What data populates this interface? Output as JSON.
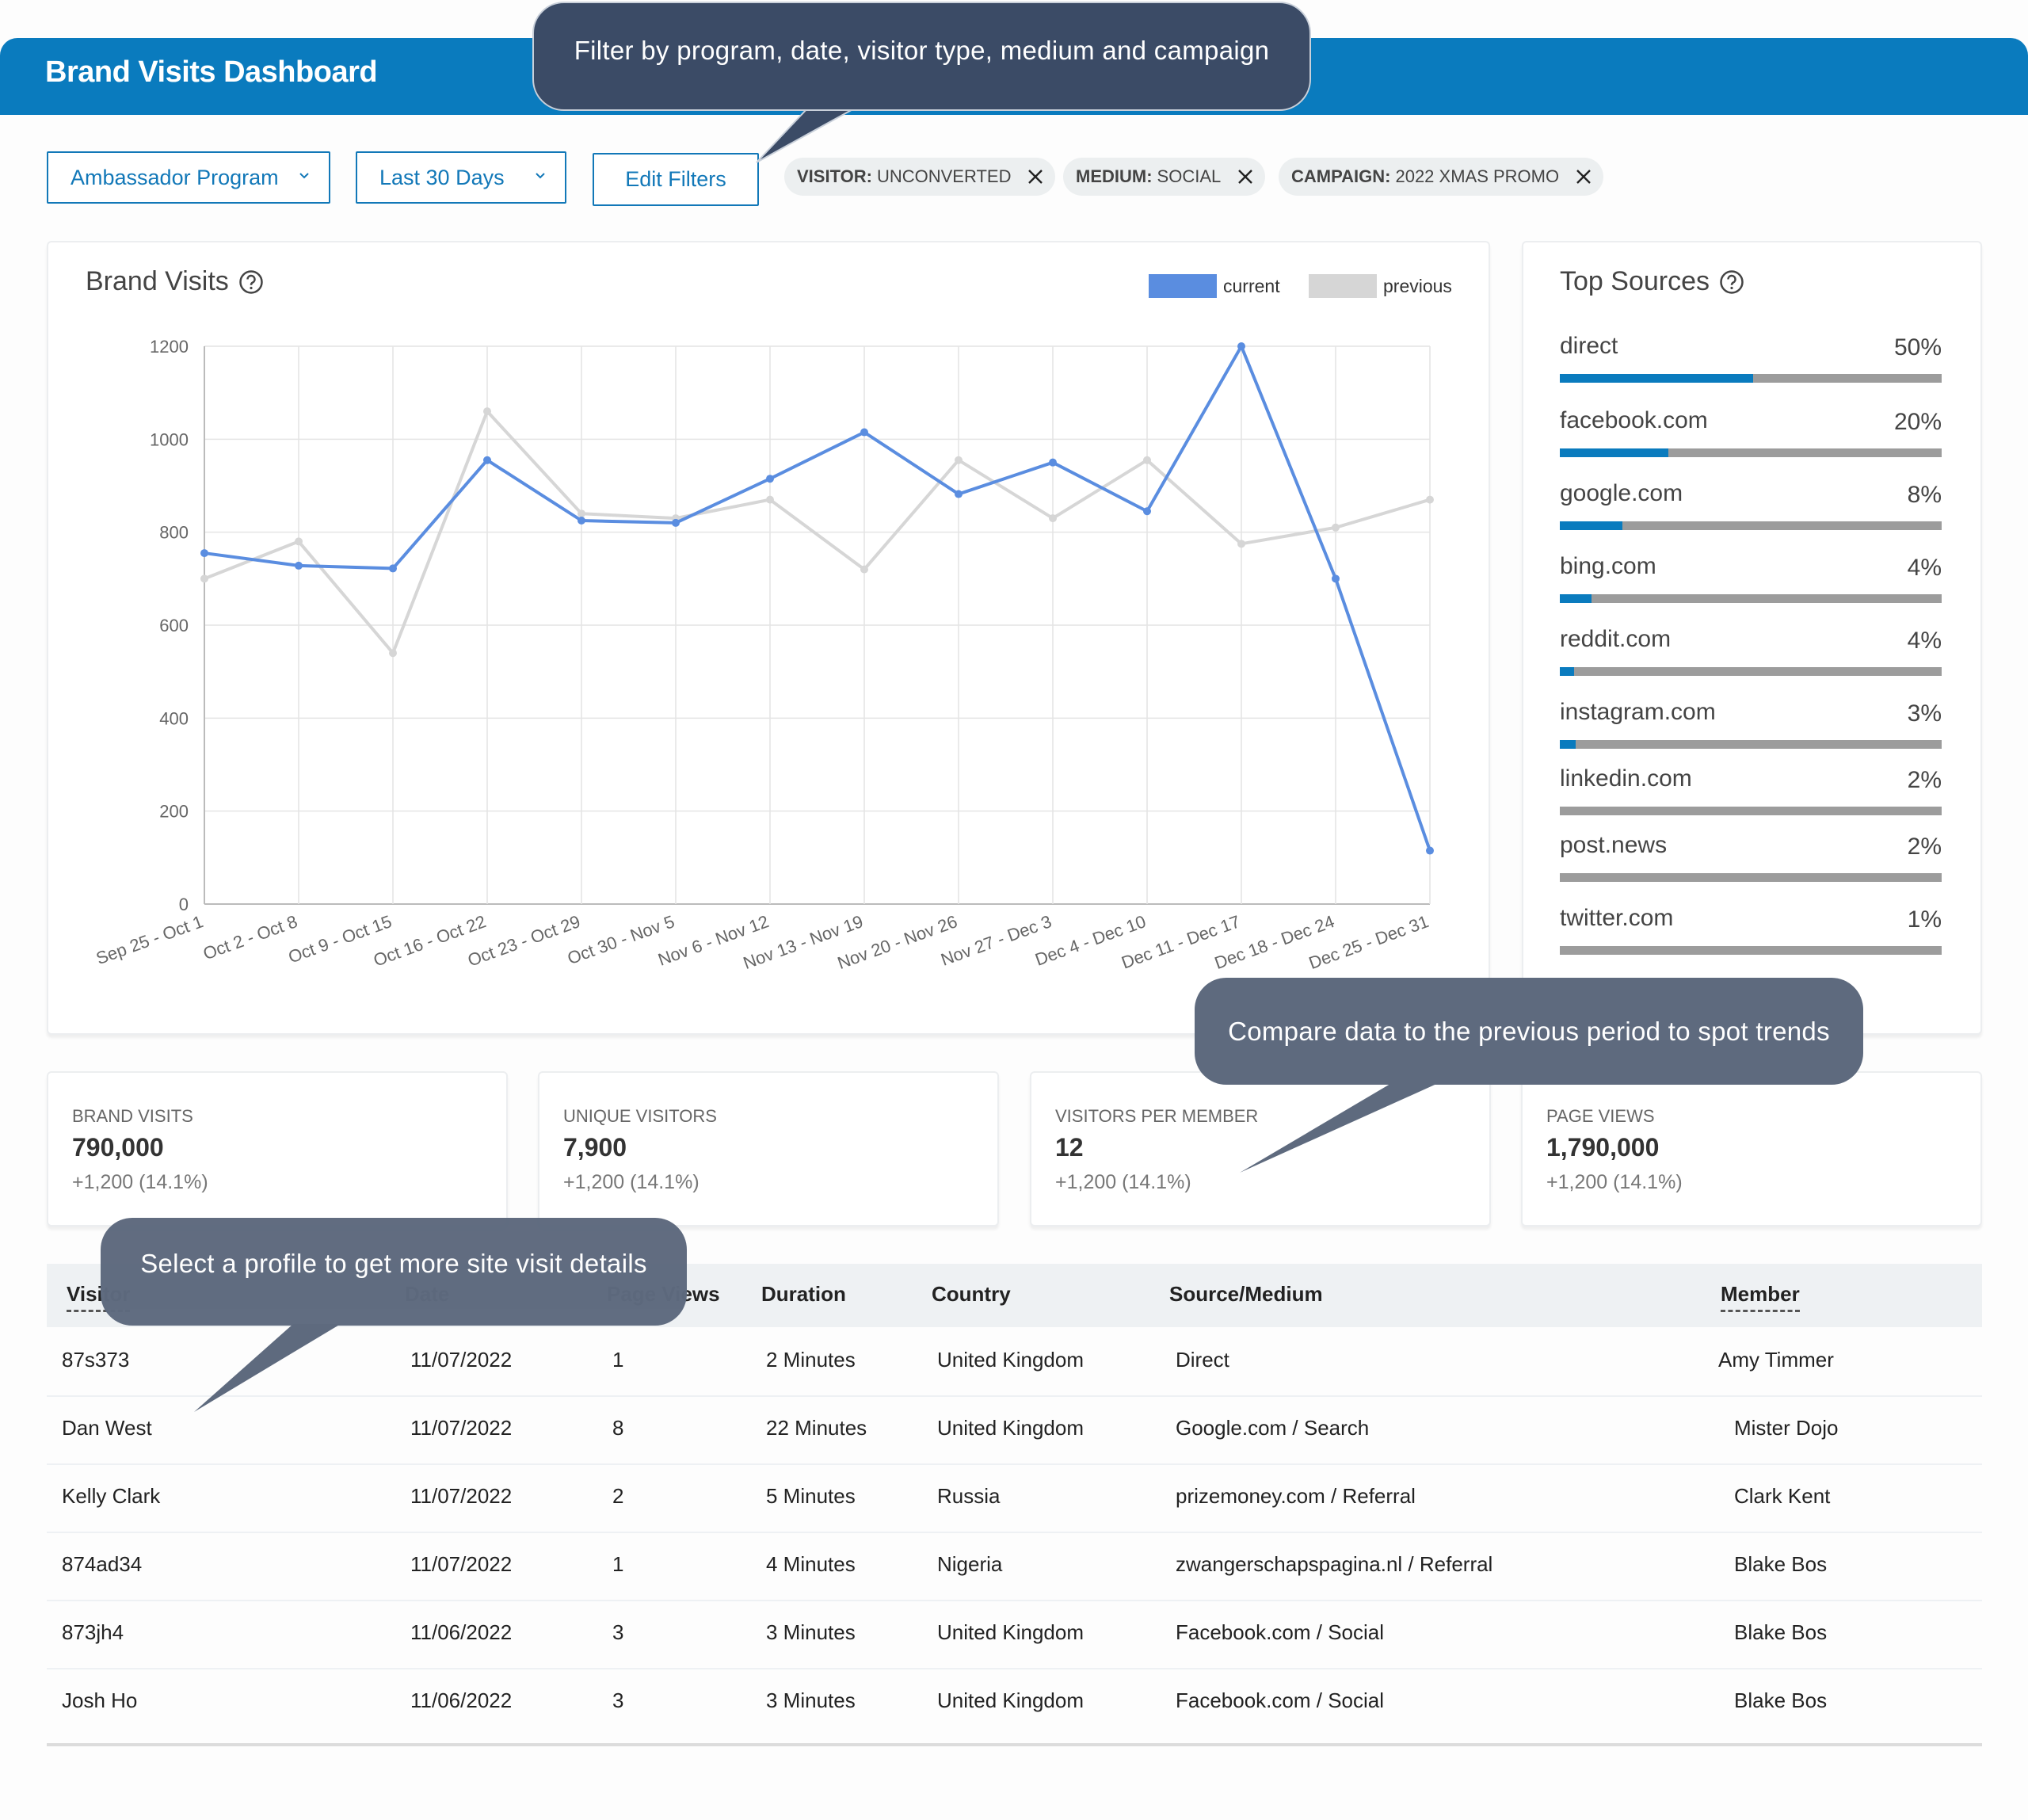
{
  "header": {
    "title": "Brand Visits Dashboard"
  },
  "filters": {
    "program_dropdown": {
      "value": "Ambassador Program",
      "icon": "chevron-down-icon"
    },
    "date_dropdown": {
      "value": "Last 30 Days",
      "icon": "chevron-down-icon"
    },
    "edit_filters_label": "Edit Filters",
    "chips": [
      {
        "key": "VISITOR:",
        "value": "UNCONVERTED",
        "icon": "close-icon"
      },
      {
        "key": "MEDIUM:",
        "value": "SOCIAL",
        "icon": "close-icon"
      },
      {
        "key": "CAMPAIGN:",
        "value": "2022 XMAS PROMO",
        "icon": "close-icon"
      }
    ]
  },
  "tooltips": {
    "filters": "Filter by program, date, visitor type, medium and campaign",
    "compare": "Compare data to the previous period to spot trends",
    "profile": "Select a profile to get more site visit details"
  },
  "chart_card": {
    "title": "Brand Visits",
    "help_icon": "help-circle-icon"
  },
  "colors": {
    "current": "#5a8de0",
    "previous": "#d6d6d6",
    "accent": "#0a7bbe",
    "track": "#9c9c9c"
  },
  "chart_data": {
    "type": "line",
    "title": "Brand Visits",
    "xlabel": "",
    "ylabel": "",
    "ylim": [
      0,
      1200
    ],
    "yticks": [
      0,
      200,
      400,
      600,
      800,
      1000,
      1200
    ],
    "grid": true,
    "legend": "top-right",
    "categories": [
      "Sep 25 - Oct 1",
      "Oct 2 - Oct 8",
      "Oct 9 - Oct 15",
      "Oct 16 - Oct 22",
      "Oct 23 - Oct 29",
      "Oct 30 - Nov 5",
      "Nov 6 - Nov 12",
      "Nov 13 - Nov 19",
      "Nov 20 - Nov 26",
      "Nov 27 - Dec 3",
      "Dec 4 - Dec 10",
      "Dec 11 - Dec 17",
      "Dec 18 - Dec 24",
      "Dec 25 - Dec 31"
    ],
    "series": [
      {
        "name": "current",
        "values": [
          755,
          728,
          722,
          955,
          825,
          820,
          915,
          1015,
          882,
          950,
          845,
          1200,
          700,
          115
        ]
      },
      {
        "name": "previous",
        "values": [
          700,
          780,
          540,
          1060,
          840,
          830,
          870,
          720,
          955,
          830,
          955,
          775,
          810,
          870
        ]
      }
    ]
  },
  "sources_card": {
    "title": "Top Sources",
    "help_icon": "help-circle-icon",
    "items": [
      {
        "name": "direct",
        "pct": "50%",
        "fill": 0.506
      },
      {
        "name": "facebook.com",
        "pct": "20%",
        "fill": 0.285
      },
      {
        "name": "google.com",
        "pct": "8%",
        "fill": 0.163
      },
      {
        "name": "bing.com",
        "pct": "4%",
        "fill": 0.082
      },
      {
        "name": "reddit.com",
        "pct": "4%",
        "fill": 0.037
      },
      {
        "name": "instagram.com",
        "pct": "3%",
        "fill": 0.042
      },
      {
        "name": "linkedin.com",
        "pct": "2%",
        "fill": 0
      },
      {
        "name": "post.news",
        "pct": "2%",
        "fill": 0
      },
      {
        "name": "twitter.com",
        "pct": "1%",
        "fill": 0
      }
    ]
  },
  "stats": [
    {
      "label": "BRAND VISITS",
      "value": "790,000",
      "change": "+1,200 (14.1%)"
    },
    {
      "label": "UNIQUE VISITORS",
      "value": "7,900",
      "change": "+1,200 (14.1%)"
    },
    {
      "label": "VISITORS PER MEMBER",
      "value": "12",
      "change": "+1,200 (14.1%)"
    },
    {
      "label": "PAGE VIEWS",
      "value": "1,790,000",
      "change": "+1,200 (14.1%)"
    }
  ],
  "table": {
    "columns": [
      "Visitor",
      "Date",
      "Page Views",
      "Duration",
      "Country",
      "Source/Medium",
      "Member"
    ],
    "rows": [
      [
        "87s373",
        "11/07/2022",
        "1",
        "2 Minutes",
        "United Kingdom",
        "Direct",
        "Amy Timmer"
      ],
      [
        "Dan West",
        "11/07/2022",
        "8",
        "22 Minutes",
        "United Kingdom",
        "Google.com / Search",
        "Mister Dojo"
      ],
      [
        "Kelly Clark",
        "11/07/2022",
        "2",
        "5 Minutes",
        "Russia",
        "prizemoney.com / Referral",
        "Clark Kent"
      ],
      [
        "874ad34",
        "11/07/2022",
        "1",
        "4 Minutes",
        "Nigeria",
        "zwangerschapspagina.nl / Referral",
        "Blake Bos"
      ],
      [
        "873jh4",
        "11/06/2022",
        "3",
        "3 Minutes",
        "United Kingdom",
        "Facebook.com / Social",
        "Blake Bos"
      ],
      [
        "Josh Ho",
        "11/06/2022",
        "3",
        "3 Minutes",
        "United Kingdom",
        "Facebook.com / Social",
        "Blake Bos"
      ]
    ]
  }
}
